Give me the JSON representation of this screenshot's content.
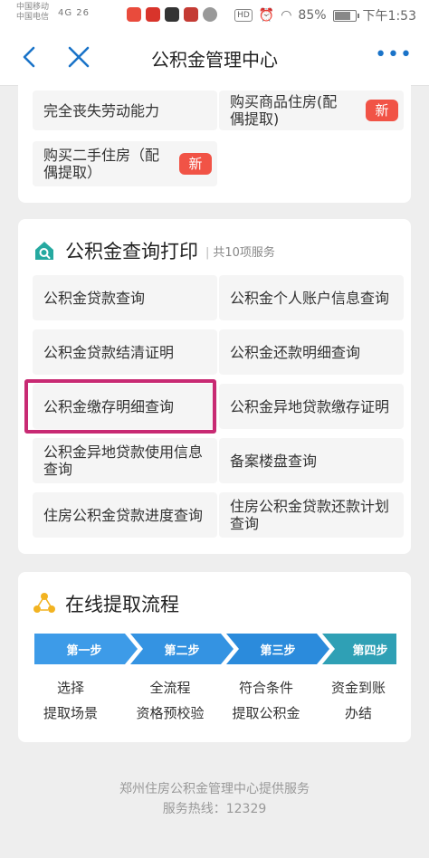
{
  "status_bar": {
    "carrier1": "中国移动",
    "carrier2": "中国电信",
    "signal": "4G 26",
    "hd": "HD",
    "battery": "85%",
    "time": "下午1:53"
  },
  "nav": {
    "title": "公积金管理中心",
    "more": "•••"
  },
  "withdraw_items": [
    {
      "label": "完全丧失劳动能力"
    },
    {
      "label": "购买商品住房(配偶提取)",
      "badge": "新"
    },
    {
      "label": "购买二手住房（配偶提取）",
      "badge": "新"
    }
  ],
  "query_section": {
    "title": "公积金查询打印",
    "subtitle": "共10项服务",
    "items": [
      "公积金贷款查询",
      "公积金个人账户信息查询",
      "公积金贷款结清证明",
      "公积金还款明细查询",
      "公积金缴存明细查询",
      "公积金异地贷款缴存证明",
      "公积金异地贷款使用信息查询",
      "备案楼盘查询",
      "住房公积金贷款进度查询",
      "住房公积金贷款还款计划查询"
    ]
  },
  "flow_section": {
    "title": "在线提取流程",
    "steps": [
      {
        "label": "第一步",
        "line1": "选择",
        "line2": "提取场景"
      },
      {
        "label": "第二步",
        "line1": "全流程",
        "line2": "资格预校验"
      },
      {
        "label": "第三步",
        "line1": "符合条件",
        "line2": "提取公积金"
      },
      {
        "label": "第四步",
        "line1": "资金到账",
        "line2": "办结"
      }
    ]
  },
  "footer": {
    "provider": "郑州住房公积金管理中心提供服务",
    "hotline": "服务热线：12329"
  },
  "colors": {
    "accent": "#1a73c8",
    "badge": "#f15346",
    "highlight": "#c82a73",
    "step1": "#3d9be8",
    "step2": "#3493e2",
    "step3": "#2b8bdc",
    "step4": "#2fa0b5"
  }
}
